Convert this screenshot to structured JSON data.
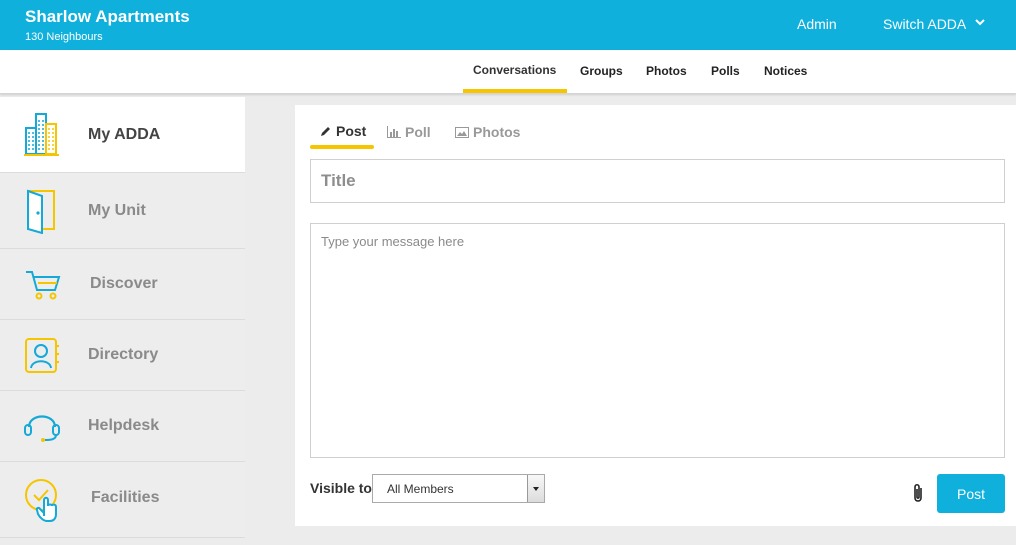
{
  "header": {
    "community_name": "Sharlow Apartments",
    "neighbours": "130 Neighbours",
    "admin_label": "Admin",
    "switch_label": "Switch ADDA"
  },
  "top_tabs": [
    {
      "label": "Conversations",
      "active": true
    },
    {
      "label": "Groups"
    },
    {
      "label": "Photos"
    },
    {
      "label": "Polls"
    },
    {
      "label": "Notices"
    }
  ],
  "sidebar": {
    "items": [
      {
        "label": "My ADDA",
        "icon": "building-icon",
        "active": true
      },
      {
        "label": "My Unit",
        "icon": "door-icon"
      },
      {
        "label": "Discover",
        "icon": "cart-icon"
      },
      {
        "label": "Directory",
        "icon": "contact-book-icon"
      },
      {
        "label": "Helpdesk",
        "icon": "headset-icon"
      },
      {
        "label": "Facilities",
        "icon": "tap-check-icon"
      }
    ]
  },
  "composer": {
    "tabs": [
      {
        "label": "Post",
        "icon": "pencil-icon",
        "active": true
      },
      {
        "label": "Poll",
        "icon": "bar-chart-icon"
      },
      {
        "label": "Photos",
        "icon": "image-icon"
      }
    ],
    "title_placeholder": "Title",
    "message_placeholder": "Type your message here",
    "visible_to_label": "Visible to",
    "visible_to_value": "All Members",
    "post_label": "Post"
  },
  "colors": {
    "brand": "#0fb0dc",
    "accent": "#f5c500"
  }
}
